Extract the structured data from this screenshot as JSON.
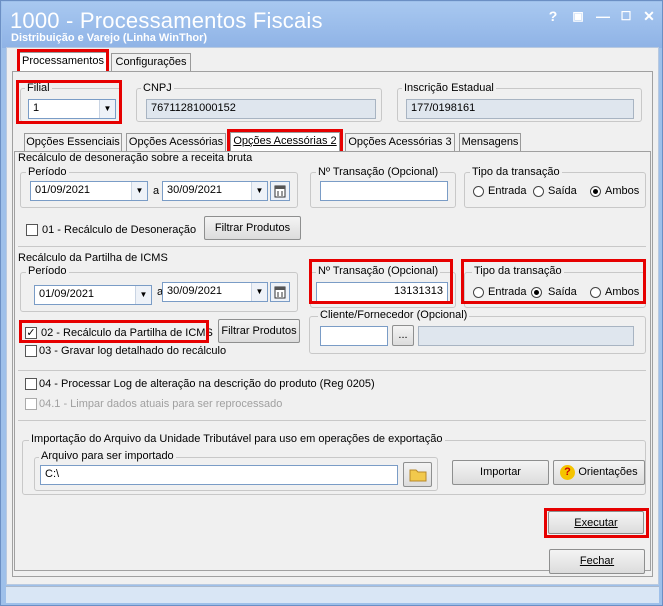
{
  "window": {
    "title": "1000 - Processamentos Fiscais",
    "subtitle": "Distribuição e Varejo (Linha WinThor)",
    "controls": [
      "?",
      "▣",
      "—",
      "☐",
      "✕"
    ]
  },
  "main_tabs": {
    "processamentos": "Processamentos",
    "configuracoes": "Configurações"
  },
  "filial": {
    "label": "Filial",
    "value": "1"
  },
  "cnpj": {
    "label": "CNPJ",
    "value": "76711281000152"
  },
  "inscricao": {
    "label": "Inscrição Estadual",
    "value": "177/0198161"
  },
  "sub_tabs": {
    "essenciais": "Opções Essenciais",
    "acessorias": "Opções Acessórias",
    "acessorias2": "Opções Acessórias 2",
    "acessorias3": "Opções Acessórias 3",
    "mensagens": "Mensagens"
  },
  "desoneracao": {
    "title": "Recálculo de desoneração sobre a receita bruta",
    "periodo_label": "Período",
    "date_from": "01/09/2021",
    "a_label": "a",
    "date_to": "30/09/2021",
    "transacao_label": "Nº Transação (Opcional)",
    "transacao_value": "",
    "tipo_label": "Tipo da transação",
    "entrada": "Entrada",
    "saida": "Saída",
    "ambos": "Ambos",
    "selected": "Ambos",
    "checkbox_label": "01 - Recálculo de Desoneração",
    "checkbox_checked": false,
    "filtrar": "Filtrar Produtos"
  },
  "partilha": {
    "title": "Recálculo da Partilha de ICMS",
    "periodo_label": "Período",
    "date_from": "01/09/2021",
    "a_label": "a",
    "date_to": "30/09/2021",
    "transacao_label": "Nº Transação (Opcional)",
    "transacao_value": "13131313",
    "tipo_label": "Tipo da transação",
    "entrada": "Entrada",
    "saida": "Saída",
    "ambos": "Ambos",
    "selected": "Saída",
    "checkbox_label": "02 - Recálculo da Partilha de ICMS",
    "checkbox_checked": true,
    "filtrar": "Filtrar Produtos",
    "log_label": "03 - Gravar log detalhado do recálculo",
    "log_checked": false,
    "cliente_label": "Cliente/Fornecedor (Opcional)",
    "cliente_code": "",
    "cliente_btn": "...",
    "cliente_name": ""
  },
  "log": {
    "label": "04 - Processar Log de alteração na descrição do produto (Reg 0205)",
    "sub_label": "04.1 - Limpar dados atuais para ser reprocessado"
  },
  "importacao": {
    "title": "Importação do Arquivo da Unidade Tributável para uso em operações de exportação",
    "arquivo_label": "Arquivo para ser importado",
    "arquivo_value": "C:\\",
    "importar": "Importar",
    "orientacoes": "Orientações"
  },
  "executar": "Executar",
  "fechar": "Fechar"
}
